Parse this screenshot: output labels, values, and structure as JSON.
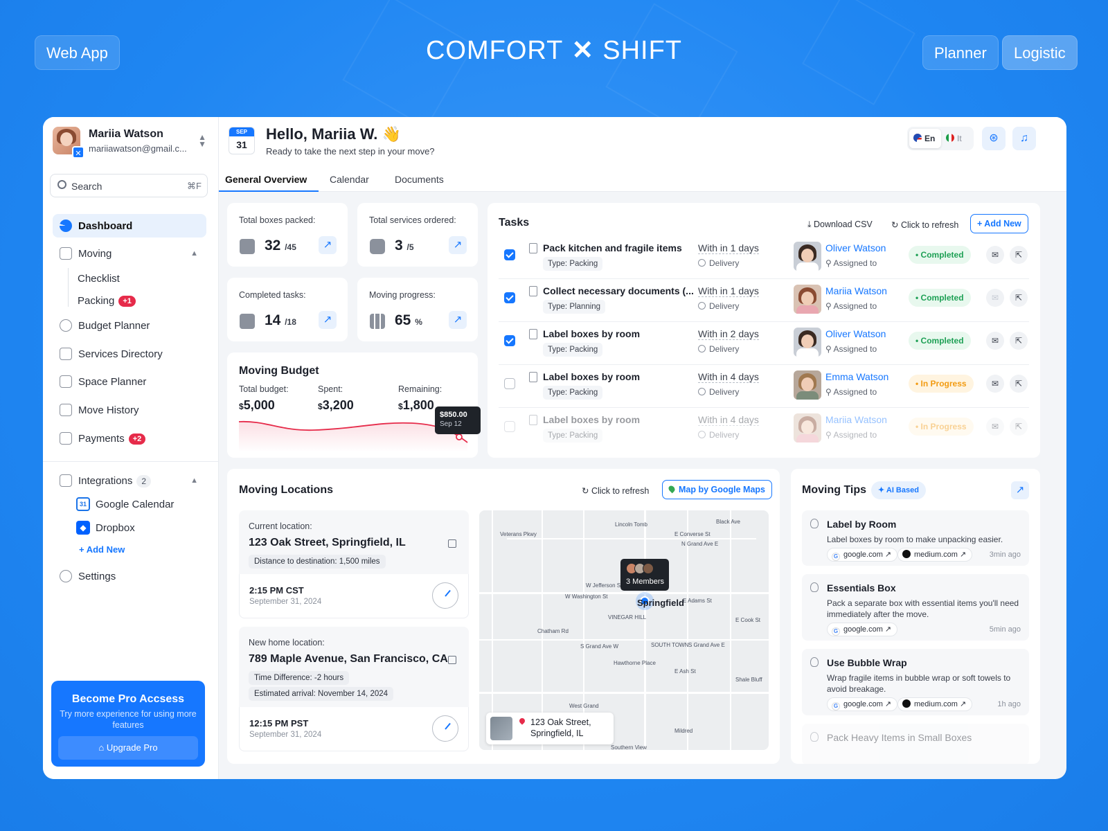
{
  "top": {
    "left_button": "Web App",
    "brand_left": "COMFORT",
    "brand_right": "SHIFT",
    "right_buttons": [
      "Planner",
      "Logistic"
    ]
  },
  "sidebar": {
    "user_name": "Mariia Watson",
    "user_email": "mariiawatson@gmail.c...",
    "search_placeholder": "Search",
    "search_shortcut": "⌘F",
    "nav": {
      "dashboard": "Dashboard",
      "moving": "Moving",
      "checklist": "Checklist",
      "packing": "Packing",
      "packing_badge": "+1",
      "budget": "Budget Planner",
      "services": "Services Directory",
      "space": "Space Planner",
      "history": "Move History",
      "payments": "Payments",
      "payments_badge": "+2"
    },
    "integrations": "Integrations",
    "integrations_count": "2",
    "google_calendar": "Google Calendar",
    "dropbox": "Dropbox",
    "add_new": "+ Add New",
    "settings": "Settings",
    "promo": {
      "title": "Become Pro Accsess",
      "desc": "Try more experience for using more features",
      "button": "Upgrade Pro"
    }
  },
  "header": {
    "cal_month": "SEP",
    "cal_day": "31",
    "greeting": "Hello, Mariia W. 👋",
    "subtitle": "Ready to take the next step in your move?",
    "lang_on": "En",
    "lang_off": "It",
    "tabs": [
      "General Overview",
      "Calendar",
      "Documents"
    ]
  },
  "stats": [
    {
      "label": "Total boxes packed:",
      "value": "32",
      "total": "/45"
    },
    {
      "label": "Total services ordered:",
      "value": "3",
      "total": "/5"
    },
    {
      "label": "Completed tasks:",
      "value": "14",
      "total": "/18"
    },
    {
      "label": "Moving progress:",
      "value": "65",
      "total": "%"
    }
  ],
  "budget": {
    "title": "Moving Budget",
    "total_label": "Total budget:",
    "total_value": "5,000",
    "spent_label": "Spent:",
    "spent_value": "3,200",
    "remaining_label": "Remaining:",
    "remaining_value": "1,800",
    "currency": "$",
    "tooltip_amount": "$850.00",
    "tooltip_date": "Sep 12"
  },
  "tasks": {
    "title": "Tasks",
    "download": "Download CSV",
    "refresh": "Click to refresh",
    "add_new": "+ Add New",
    "assigned_label": "Assigned to",
    "delivery_label": "Delivery",
    "rows": [
      {
        "name": "Pack kitchen and fragile items",
        "type": "Type: Packing",
        "due": "With in 1 days",
        "person": "Oliver Watson",
        "status": "Completed",
        "checked": true
      },
      {
        "name": "Collect necessary documents (...",
        "type": "Type: Planning",
        "due": "With in 1 days",
        "person": "Mariia Watson",
        "status": "Completed",
        "checked": true
      },
      {
        "name": "Label boxes by room",
        "type": "Type: Packing",
        "due": "With in 2 days",
        "person": "Oliver Watson",
        "status": "Completed",
        "checked": true
      },
      {
        "name": "Label boxes by room",
        "type": "Type: Packing",
        "due": "With in 4 days",
        "person": "Emma Watson",
        "status": "In Progress",
        "checked": false
      },
      {
        "name": "Label boxes by room",
        "type": "Type: Packing",
        "due": "With in 4 days",
        "person": "Mariia Watson",
        "status": "In Progress",
        "checked": false
      }
    ]
  },
  "locations": {
    "title": "Moving Locations",
    "refresh": "Click to refresh",
    "map_button": "Map by Google Maps",
    "current": {
      "label": "Current location:",
      "address": "123 Oak Street, Springfield, IL",
      "chip": "Distance to destination: 1,500 miles",
      "time": "2:15 PM CST",
      "date": "September 31, 2024"
    },
    "new": {
      "label": "New home location:",
      "address": "789 Maple Avenue, San Francisco, CA",
      "chip1": "Time Difference: -2 hours",
      "chip2": "Estimated arrival: November 14, 2024",
      "time": "12:15 PM PST",
      "date": "September 31, 2024"
    },
    "map": {
      "members": "3 Members",
      "city": "Springfield",
      "card_line1": "123 Oak Street,",
      "card_line2": "Springfield, IL",
      "labels": [
        "Lincoln Tomb",
        "N Grand Ave E",
        "E Converse St",
        "Black Ave",
        "W Jefferson St",
        "W Washington St",
        "VINEGAR HILL",
        "S Grand Ave W",
        "SOUTH TOWN",
        "S Grand Ave E",
        "Hawthorne Place",
        "Shale Bluff",
        "West Grand",
        "Mildred",
        "Southern View",
        "Veterans Pkwy",
        "Chatham Rd",
        "E Cook St",
        "E Adams St",
        "E Ash St"
      ]
    }
  },
  "tips": {
    "title": "Moving Tips",
    "ai_label": "AI Based",
    "items": [
      {
        "title": "Label by Room",
        "desc": "Label boxes by room to make unpacking easier.",
        "sources": [
          "google.com",
          "medium.com"
        ],
        "ago": "3min ago"
      },
      {
        "title": "Essentials Box",
        "desc": "Pack a separate box with essential items you'll need immediately after the move.",
        "sources": [
          "google.com"
        ],
        "ago": "5min ago"
      },
      {
        "title": "Use Bubble Wrap",
        "desc": "Wrap fragile items in bubble wrap or soft towels to avoid breakage.",
        "sources": [
          "google.com",
          "medium.com"
        ],
        "ago": "1h ago"
      },
      {
        "title": "Pack Heavy Items in Small Boxes",
        "desc": "",
        "sources": [],
        "ago": ""
      }
    ]
  },
  "colors": {
    "accent": "#1677ff",
    "background": "#1f86f2",
    "completed": "#1ea055",
    "in_progress": "#f29b11",
    "danger": "#e62b4a"
  }
}
